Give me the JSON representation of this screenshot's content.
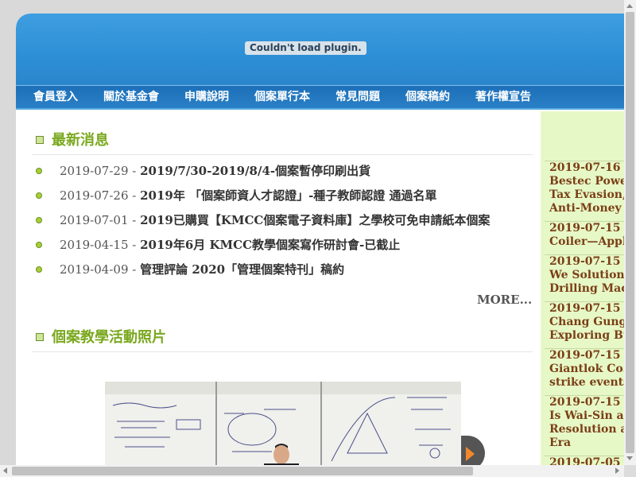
{
  "banner": {
    "plugin_message": "Couldn't load plugin."
  },
  "nav": {
    "items": [
      "會員登入",
      "關於基金會",
      "申購說明",
      "個案單行本",
      "常見問題",
      "個案稿約",
      "著作權宣告"
    ]
  },
  "news": {
    "heading": "最新消息",
    "items": [
      {
        "date": "2019-07-29",
        "title": "2019/7/30-2019/8/4-個案暫停印刷出貨"
      },
      {
        "date": "2019-07-26",
        "title": "2019年 「個案師資人才認證」-種子教師認證 通過名單"
      },
      {
        "date": "2019-07-01",
        "title": "2019已購買【KMCC個案電子資料庫】之學校可免申請紙本個案"
      },
      {
        "date": "2019-04-15",
        "title": "2019年6月 KMCC教學個案寫作研討會-已截止"
      },
      {
        "date": "2019-04-09",
        "title": "管理評論 2020「管理個案特刊」稿約"
      }
    ],
    "more_label": "MORE..."
  },
  "photos": {
    "heading": "個案教學活動照片"
  },
  "sidebar": {
    "items": [
      {
        "date": "2019-07-16",
        "lines": [
          "Bestec Power E",
          "Tax Evasion, C",
          "Anti-Money La"
        ]
      },
      {
        "date": "2019-07-15",
        "lines": [
          "Coiler—Applic"
        ]
      },
      {
        "date": "2019-07-15",
        "lines": [
          "We Solutions T",
          "Drilling Machi"
        ]
      },
      {
        "date": "2019-07-15",
        "lines": [
          "Chang Gung H",
          "Exploring Busi"
        ]
      },
      {
        "date": "2019-07-15",
        "lines": [
          "Giantlok Co., l",
          "strike events ir"
        ]
      },
      {
        "date": "2019-07-15",
        "lines": [
          "Is Wai-Sin a Yo",
          "Resolution and",
          "Era"
        ]
      },
      {
        "date": "2019-07-05",
        "lines": []
      }
    ]
  },
  "colors": {
    "banner": "#2d8fd6",
    "section_heading": "#7aa81e",
    "sidebar_bg": "#e7f8c7",
    "sidebar_text": "#7b3f17"
  }
}
